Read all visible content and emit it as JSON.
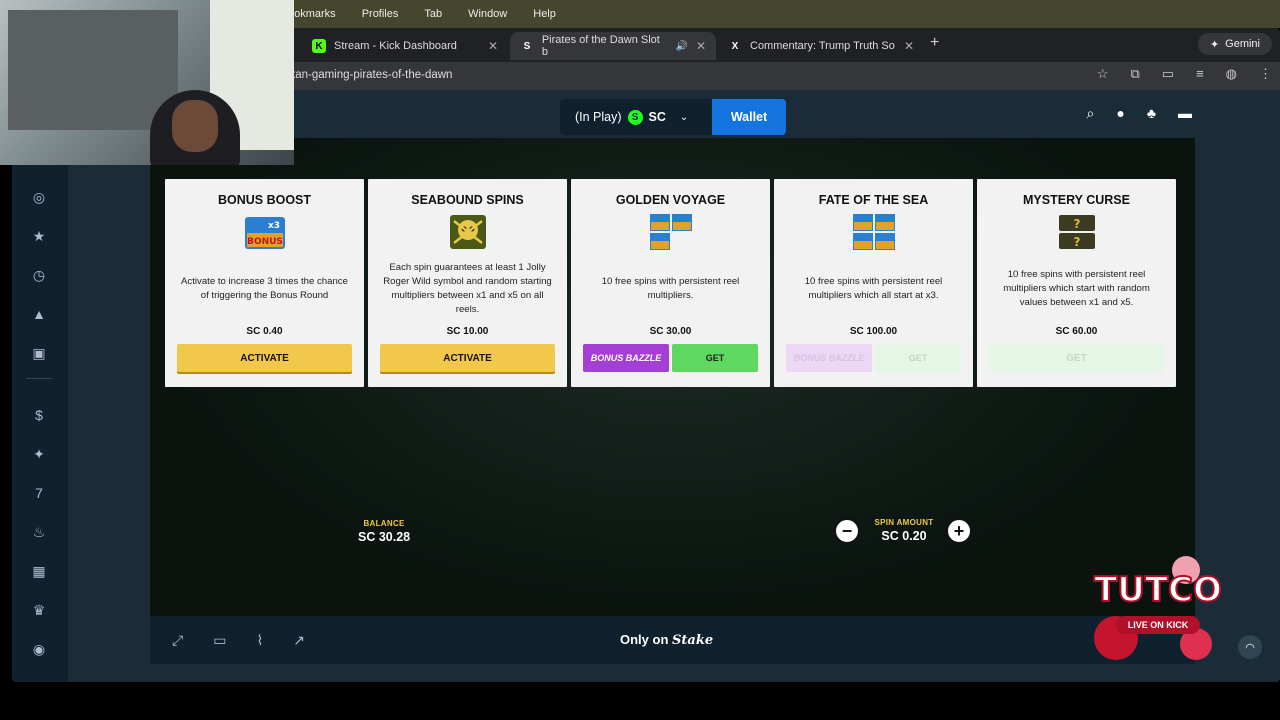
{
  "os_menu": [
    "ookmarks",
    "Profiles",
    "Tab",
    "Window",
    "Help"
  ],
  "tabs": [
    {
      "title": "Stream - Kick Dashboard",
      "favicon": "K"
    },
    {
      "title": "Pirates of the Dawn Slot b",
      "favicon": "S"
    },
    {
      "title": "Commentary: Trump Truth So",
      "favicon": "X"
    }
  ],
  "gemini_label": "Gemini",
  "url": "tan-gaming-pirates-of-the-dawn",
  "topnav": {
    "in_play_label": "(In Play)",
    "currency": "SC",
    "wallet_label": "Wallet"
  },
  "cards": [
    {
      "title": "BONUS BOOST",
      "icon": "bonus-chest-x3-icon",
      "description": "Activate to increase 3 times the chance of triggering the Bonus Round",
      "price": "SC 0.40",
      "button": "ACTIVATE"
    },
    {
      "title": "SEABOUND SPINS",
      "icon": "jolly-roger-skull-icon",
      "description": "Each spin guarantees at least 1 Jolly Roger Wild symbol and random starting multipliers between x1 and x5 on all reels.",
      "price": "SC 10.00",
      "button": "ACTIVATE"
    },
    {
      "title": "GOLDEN VOYAGE",
      "icon": "bonus-chests-3-icon",
      "description": "10 free spins with persistent reel multipliers.",
      "price": "SC 30.00",
      "bazzle_label": "BONUS BAZZLE",
      "get_label": "GET"
    },
    {
      "title": "FATE OF THE SEA",
      "icon": "bonus-chests-4-icon",
      "description": "10 free spins with persistent reel multipliers which all start at x3.",
      "price": "SC 100.00",
      "bazzle_label": "BONUS BAZZLE",
      "get_label": "GET"
    },
    {
      "title": "MYSTERY CURSE",
      "icon": "mystery-chests-icon",
      "description": "10 free spins with persistent reel multipliers which start with random values between x1 and x5.",
      "price": "SC 60.00",
      "button": "GET"
    }
  ],
  "balance": {
    "label": "BALANCE",
    "value": "SC 30.28"
  },
  "spin_amount": {
    "label": "SPIN AMOUNT",
    "value": "SC 0.20",
    "minus": "−",
    "plus": "+"
  },
  "footer": {
    "only_on": "Only on",
    "brand": "Stake"
  },
  "streamer_logo": {
    "text": "TUTCO",
    "sub": "LIVE ON KICK"
  },
  "colors": {
    "activate": "#f2c84b",
    "get": "#5ed85e",
    "bazzle": "#a43ed4",
    "wallet": "#1475e1",
    "sc_coin": "#1fff20"
  }
}
